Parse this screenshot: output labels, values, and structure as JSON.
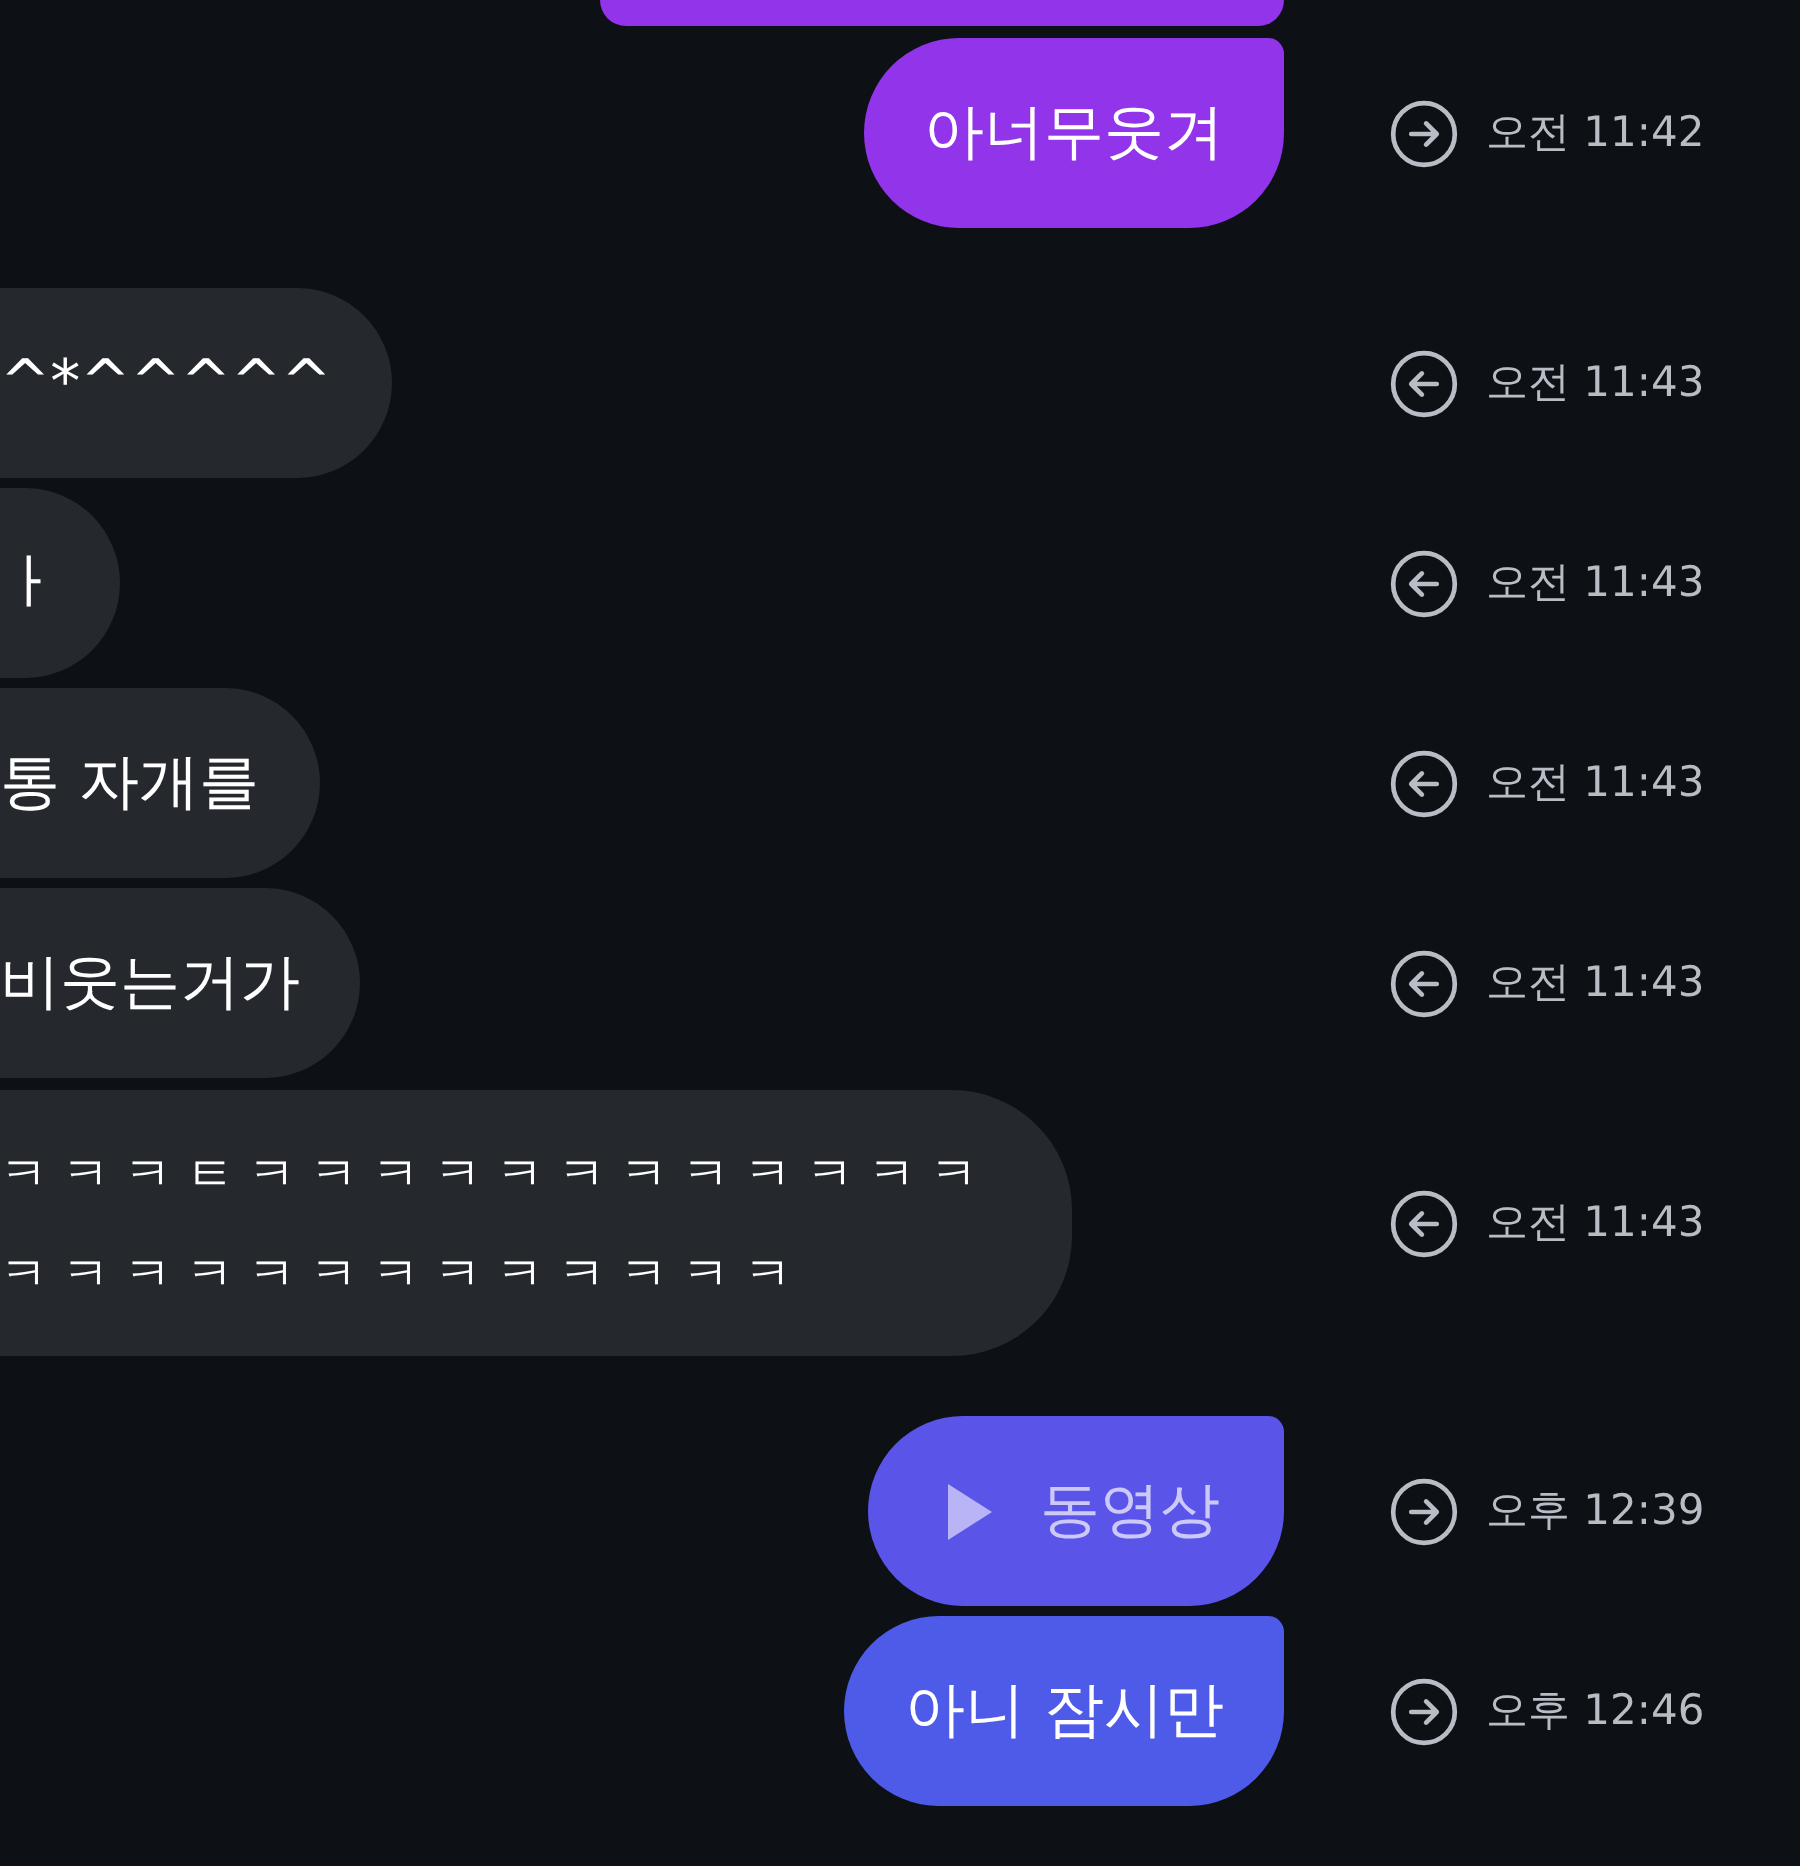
{
  "messages": [
    {
      "kind": "clipped",
      "outgoing": true,
      "color": "#9234ea"
    },
    {
      "kind": "text",
      "outgoing": true,
      "color": "#9234ea",
      "lines": [
        "아너무웃겨"
      ],
      "time": "오전 11:42"
    },
    {
      "kind": "text",
      "outgoing": false,
      "color": "#25282d",
      "lines": [
        "^*^^^^^"
      ],
      "time": "오전 11:43"
    },
    {
      "kind": "text",
      "outgoing": false,
      "color": "#25282d",
      "lines": [
        "ㅏ"
      ],
      "time": "오전 11:43"
    },
    {
      "kind": "text",
      "outgoing": false,
      "color": "#25282d",
      "lines": [
        "통 자개를"
      ],
      "time": "오전 11:43"
    },
    {
      "kind": "text",
      "outgoing": false,
      "color": "#25282d",
      "lines": [
        "비웃는거가"
      ],
      "time": "오전 11:43"
    },
    {
      "kind": "laugh",
      "outgoing": false,
      "color": "#25282d",
      "lines": [
        "ㅋㅋㅋㅌㅋㅋㅋㅋㅋㅋㅋㅋㅋㅋㅋㅋ",
        "ㅋㅋㅋㅋㅋㅋㅋㅋㅋㅋㅋㅋㅋ"
      ],
      "time": "오전 11:43"
    },
    {
      "kind": "video",
      "outgoing": true,
      "color": "#5a54e9",
      "lines": [
        "동영상"
      ],
      "time": "오후 12:39"
    },
    {
      "kind": "text",
      "outgoing": true,
      "color": "#4e5ae8",
      "lines": [
        "아니 잠시만"
      ],
      "time": "오후 12:46"
    }
  ]
}
